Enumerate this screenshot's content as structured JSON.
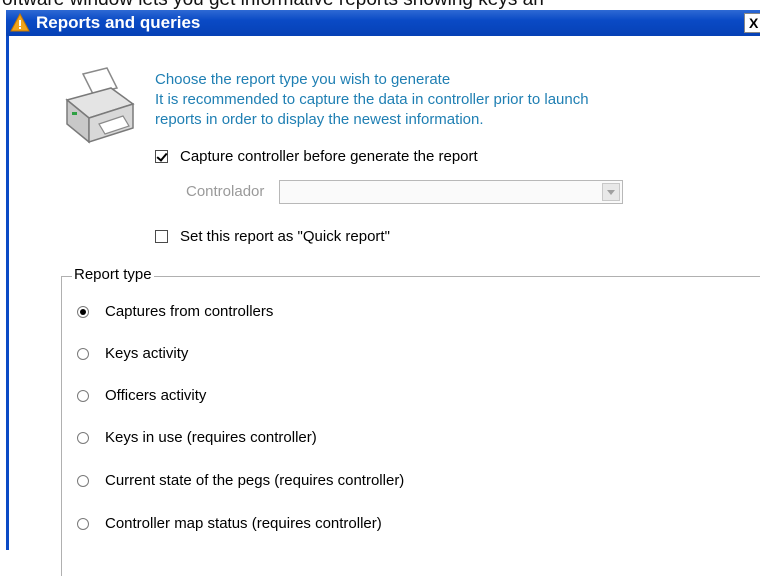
{
  "caption": "oftware window lets you get informative reports showing keys an",
  "window": {
    "title": "Reports and queries",
    "close_label": "X"
  },
  "intro": {
    "lines": [
      "Choose the report type you wish to generate",
      "It is recommended to capture the data in controller prior to launch",
      "reports in order to display the newest information."
    ]
  },
  "options": {
    "capture": {
      "label": "Capture controller before generate the report",
      "checked": true
    },
    "controller": {
      "label": "Controlador",
      "value": ""
    },
    "quick": {
      "label": "Set this report as \"Quick report\"",
      "checked": false
    }
  },
  "report_type": {
    "legend": "Report type",
    "items": [
      {
        "label": "Captures from controllers",
        "selected": true
      },
      {
        "label": "Keys activity",
        "selected": false
      },
      {
        "label": "Officers activity",
        "selected": false
      },
      {
        "label": "Keys in use (requires controller)",
        "selected": false
      },
      {
        "label": "Current state of the pegs (requires controller)",
        "selected": false
      },
      {
        "label": "Controller map status (requires controller)",
        "selected": false
      }
    ]
  },
  "colors": {
    "titlebar": "#0a4ac5",
    "intro_text": "#1f7fb3"
  },
  "icons": {
    "app": "warning-triangle-icon",
    "printer": "printer-icon"
  }
}
